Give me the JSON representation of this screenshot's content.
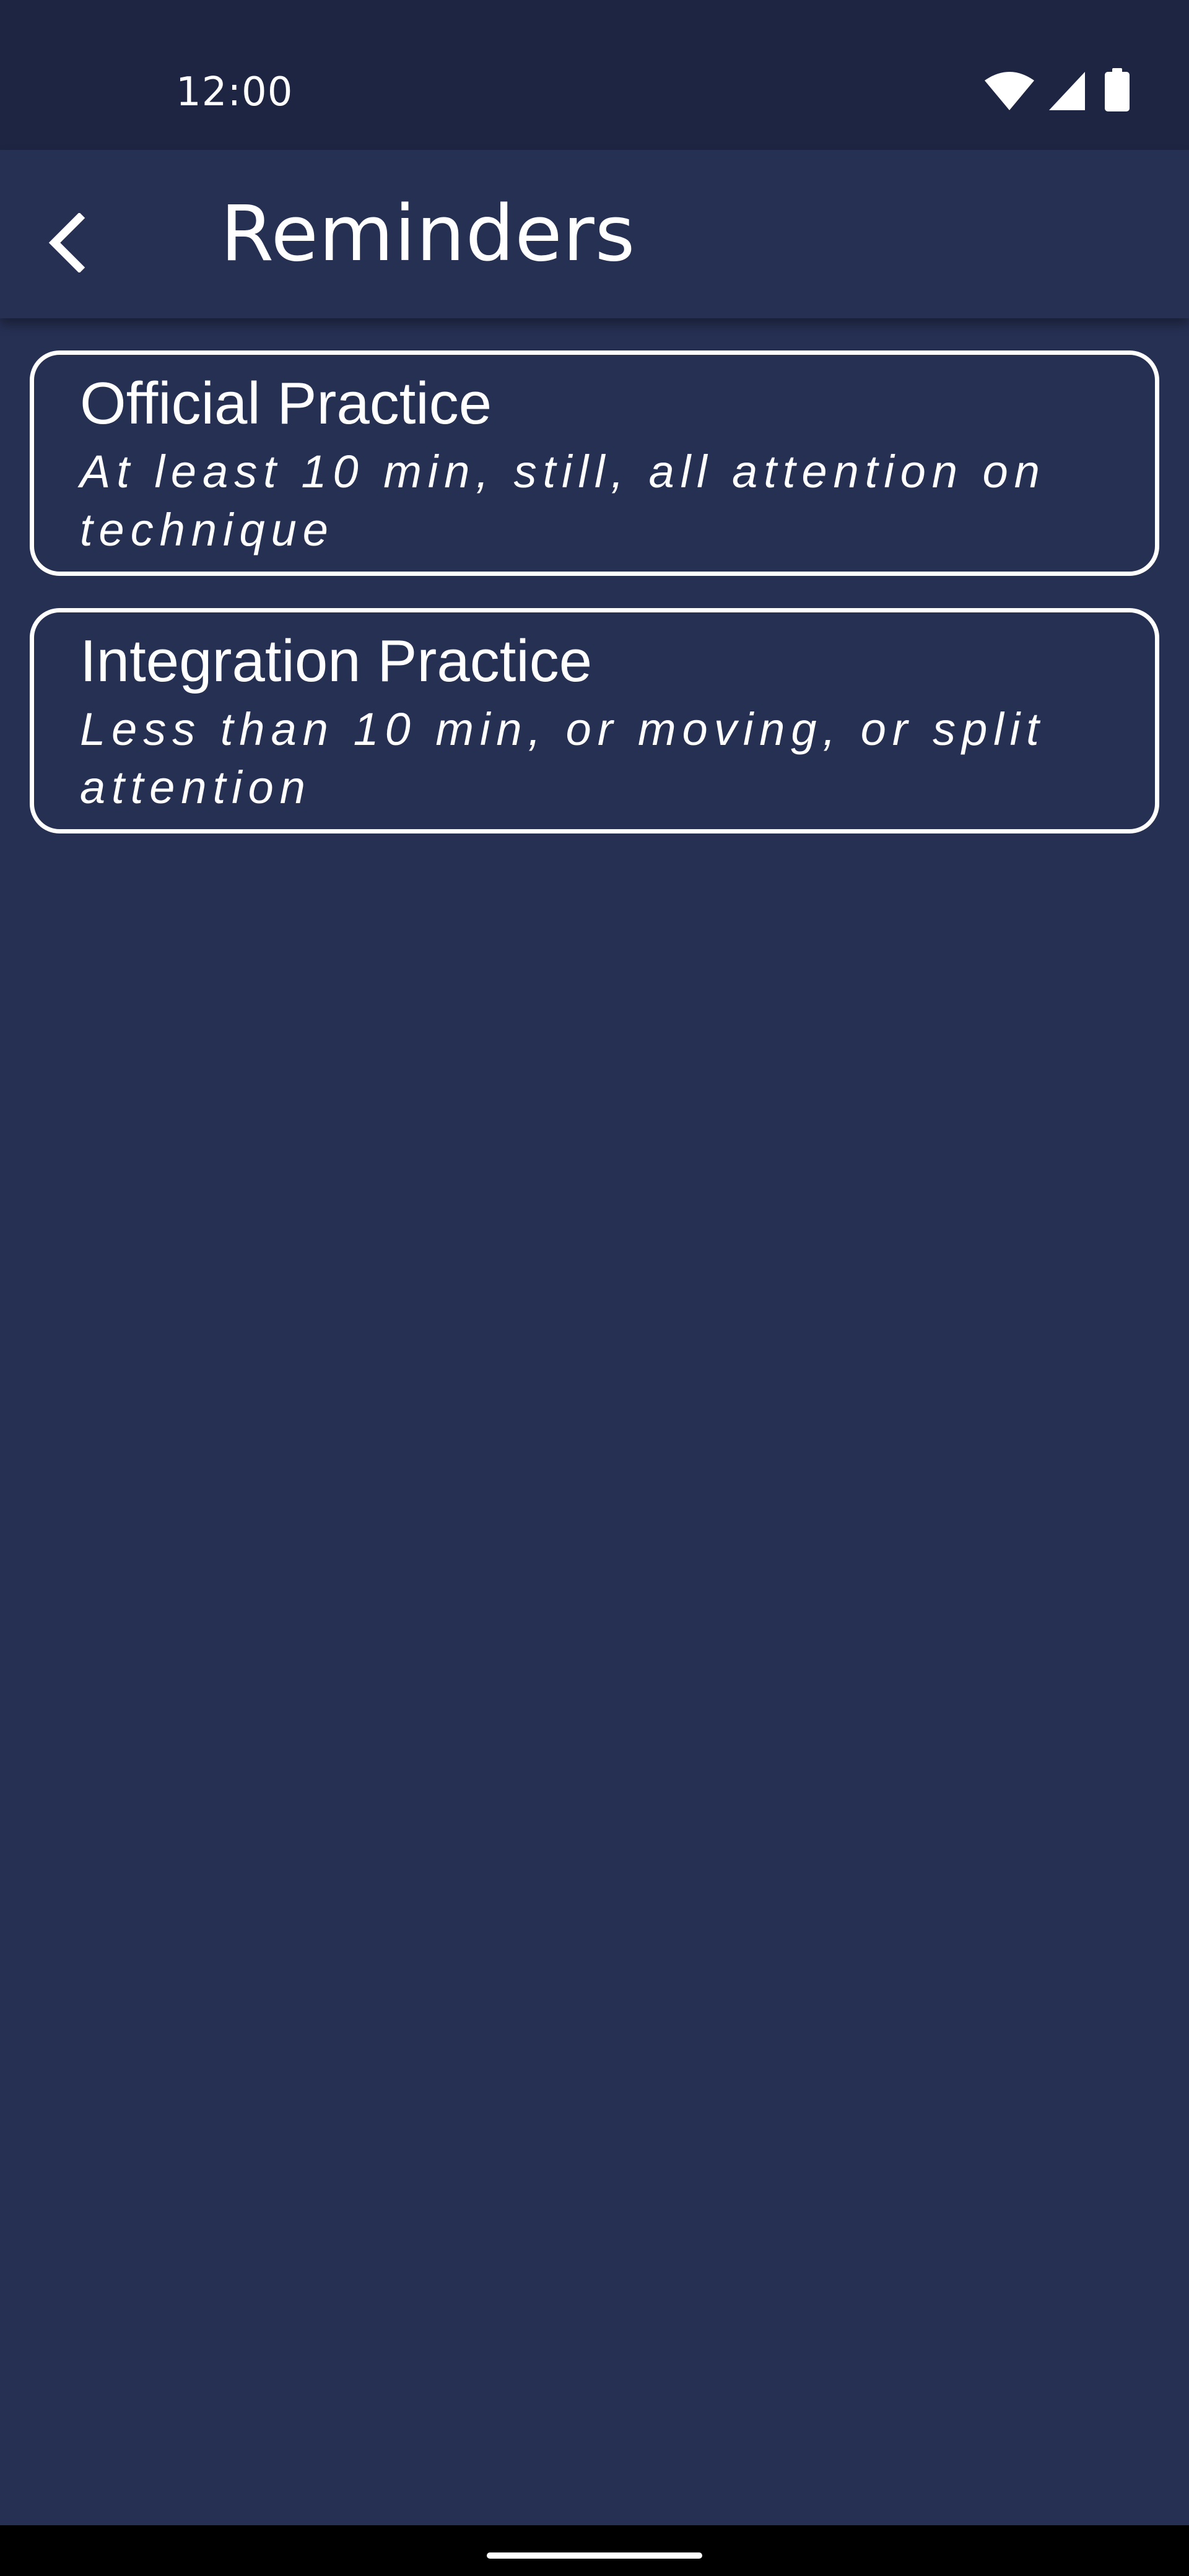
{
  "status_bar": {
    "time": "12:00",
    "icons": [
      "wifi-icon",
      "signal-icon",
      "battery-icon"
    ]
  },
  "app_bar": {
    "back_icon": "chevron-left-icon",
    "title": "Reminders"
  },
  "cards": [
    {
      "title": "Official Practice",
      "subtitle": "At least 10 min, still, all attention on technique"
    },
    {
      "title": "Integration Practice",
      "subtitle": "Less than 10 min, or moving, or split attention"
    }
  ],
  "colors": {
    "background": "#263053",
    "status_bar": "#1e2542",
    "text": "#ffffff",
    "card_border": "#ffffff",
    "nav_bar": "#000000"
  }
}
